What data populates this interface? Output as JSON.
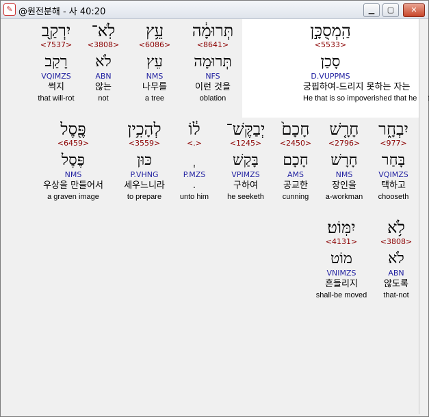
{
  "window": {
    "title": "@원전분해 - 사 40:20",
    "buttons": {
      "minimize": "▁",
      "maximize": "▢",
      "close": "✕"
    }
  },
  "rows": [
    {
      "words": [
        {
          "heb": "הַֽמְסֻכָּ֣ן",
          "strong": "<5533>",
          "lemma": "סָכַן",
          "morph": "D.VUPPMS",
          "kor": "궁핍하여-드리지 못하는 자는",
          "eng": "He that is so impoverished that he hath no"
        },
        {
          "heb": "תְּרוּמָ֔ה",
          "strong": "<8641>",
          "lemma": "תְּרוּמָה",
          "morph": "NFS",
          "kor": "이런 것을",
          "eng": "oblation"
        },
        {
          "heb": "עֵ֥ץ",
          "strong": "<6086>",
          "lemma": "עֵץ",
          "morph": "NMS",
          "kor": "나무를",
          "eng": "a tree"
        },
        {
          "heb": "לֹֽא־",
          "strong": "<3808>",
          "lemma": "לֹא",
          "morph": "ABN",
          "kor": "않는",
          "eng": "not"
        },
        {
          "heb": "יִרְקַ֖ב",
          "strong": "<7537>",
          "lemma": "רָקַב",
          "morph": "VQIMZS",
          "kor": "썩지",
          "eng": "that will-rot"
        }
      ]
    },
    {
      "words": [
        {
          "heb": "יִבְחָ֑ר",
          "strong": "<977>",
          "lemma": "בָּחַר",
          "morph": "VQIMZS",
          "kor": "택하고",
          "eng": "chooseth"
        },
        {
          "heb": "חָרָ֤שׁ",
          "strong": "<2796>",
          "lemma": "חָרָשׁ",
          "morph": "NMS",
          "kor": "장인을",
          "eng": "a-workman"
        },
        {
          "heb": "חָכָם֙",
          "strong": "<2450>",
          "lemma": "חָכָם",
          "morph": "AMS",
          "kor": "공교한",
          "eng": "cunning"
        },
        {
          "heb": "יְבַקֶּשׁ־",
          "strong": "<1245>",
          "lemma": "בָּקַשׁ",
          "morph": "VPIMZS",
          "kor": "구하여",
          "eng": "he seeketh"
        },
        {
          "heb": "ל֔וֹ",
          "strong": "<.>",
          "lemma": "ְ",
          "morph": "P.MZS",
          "kor": ".",
          "eng": "unto him"
        },
        {
          "heb": "לְהָכִ֥ין",
          "strong": "<3559>",
          "lemma": "כּוּן",
          "morph": "P.VHNG",
          "kor": "세우느니라",
          "eng": "to prepare"
        },
        {
          "heb": "פֶּ֖סֶל",
          "strong": "<6459>",
          "lemma": "פֶּסֶל",
          "morph": "NMS",
          "kor": "우상을 만들어서",
          "eng": "a graven image"
        }
      ]
    },
    {
      "words": [
        {
          "heb": "לֹ֥א",
          "strong": "<3808>",
          "lemma": "לֹא",
          "morph": "ABN",
          "kor": "않도록",
          "eng": "that-not"
        },
        {
          "heb": "יִמּֽוֹט׃",
          "strong": "<4131>",
          "lemma": "מוֹט",
          "morph": "VNIMZS",
          "kor": "흔들리지",
          "eng": "shall-be moved"
        }
      ]
    }
  ]
}
